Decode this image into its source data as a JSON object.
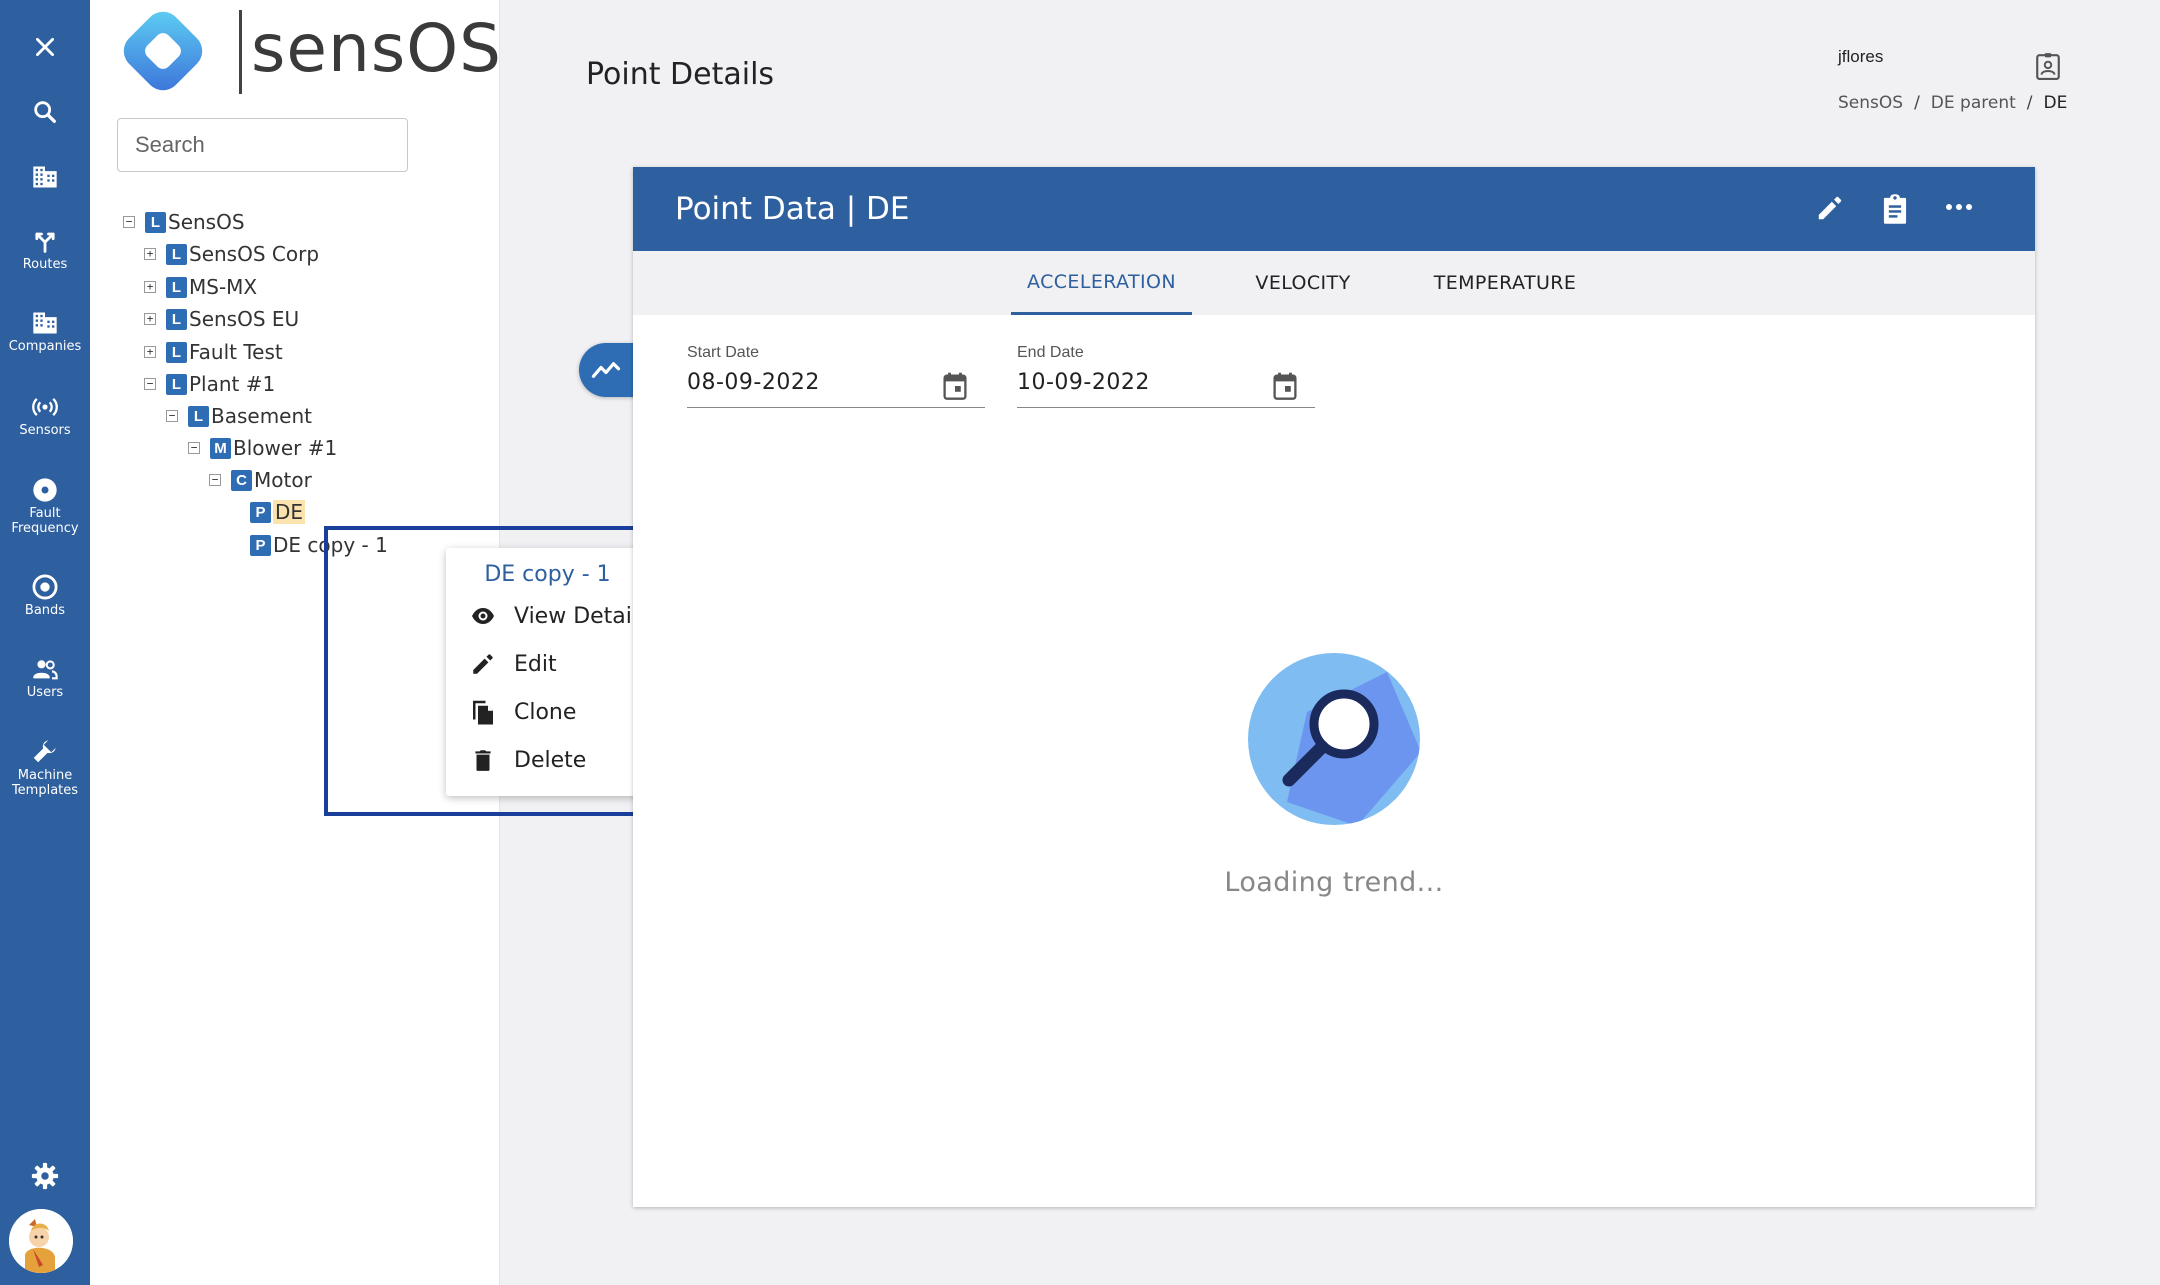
{
  "rail": {
    "items": [
      {
        "name": "close",
        "label": ""
      },
      {
        "name": "search",
        "label": ""
      },
      {
        "name": "buildings",
        "label": ""
      },
      {
        "name": "routes",
        "label": "Routes"
      },
      {
        "name": "companies",
        "label": "Companies"
      },
      {
        "name": "sensors",
        "label": "Sensors"
      },
      {
        "name": "fault-frequency",
        "label": "Fault Frequency"
      },
      {
        "name": "bands",
        "label": "Bands"
      },
      {
        "name": "users",
        "label": "Users"
      },
      {
        "name": "machine-templates",
        "label": "Machine Templates"
      }
    ],
    "settings_icon": "gear-icon",
    "color": "#2e5f9e"
  },
  "logo": {
    "text": "sensOS"
  },
  "search": {
    "placeholder": "Search"
  },
  "tree": {
    "nodes": [
      {
        "badge": "L",
        "label": "SensOS",
        "toggle": "−"
      },
      {
        "badge": "L",
        "label": "SensOS Corp",
        "toggle": "+"
      },
      {
        "badge": "L",
        "label": "MS-MX",
        "toggle": "+"
      },
      {
        "badge": "L",
        "label": "SensOS EU",
        "toggle": "+"
      },
      {
        "badge": "L",
        "label": "Fault Test",
        "toggle": "+"
      },
      {
        "badge": "L",
        "label": "Plant #1",
        "toggle": "−"
      },
      {
        "badge": "L",
        "label": "Basement",
        "toggle": "−"
      },
      {
        "badge": "M",
        "label": "Blower #1",
        "toggle": "−"
      },
      {
        "badge": "C",
        "label": "Motor",
        "toggle": "−"
      },
      {
        "badge": "P",
        "label": "DE",
        "selected": true
      },
      {
        "badge": "P",
        "label": "DE copy - 1"
      }
    ]
  },
  "context_menu": {
    "title": "DE copy - 1",
    "items": [
      {
        "label": "View Detail",
        "icon": "eye-icon"
      },
      {
        "label": "Edit",
        "icon": "pencil-icon"
      },
      {
        "label": "Clone",
        "icon": "copy-icon"
      },
      {
        "label": "Delete",
        "icon": "trash-icon"
      }
    ]
  },
  "header": {
    "page_title": "Point Details",
    "user": "jflores",
    "breadcrumb": [
      "SensOS",
      "DE parent",
      "DE"
    ]
  },
  "card": {
    "title": "Point Data | DE",
    "actions": [
      "pencil-icon",
      "clipboard-icon",
      "more-horizontal-icon"
    ],
    "tabs": [
      {
        "label": "ACCELERATION",
        "active": true
      },
      {
        "label": "VELOCITY"
      },
      {
        "label": "TEMPERATURE"
      }
    ],
    "start_date": {
      "label": "Start Date",
      "value": "08-09-2022"
    },
    "end_date": {
      "label": "End Date",
      "value": "10-09-2022"
    },
    "loading_text": "Loading trend..."
  },
  "colors": {
    "primary": "#2e5f9e",
    "badge": "#2e6db4",
    "highlight": "#fbe3ad",
    "focus": "#1a3f9a"
  }
}
